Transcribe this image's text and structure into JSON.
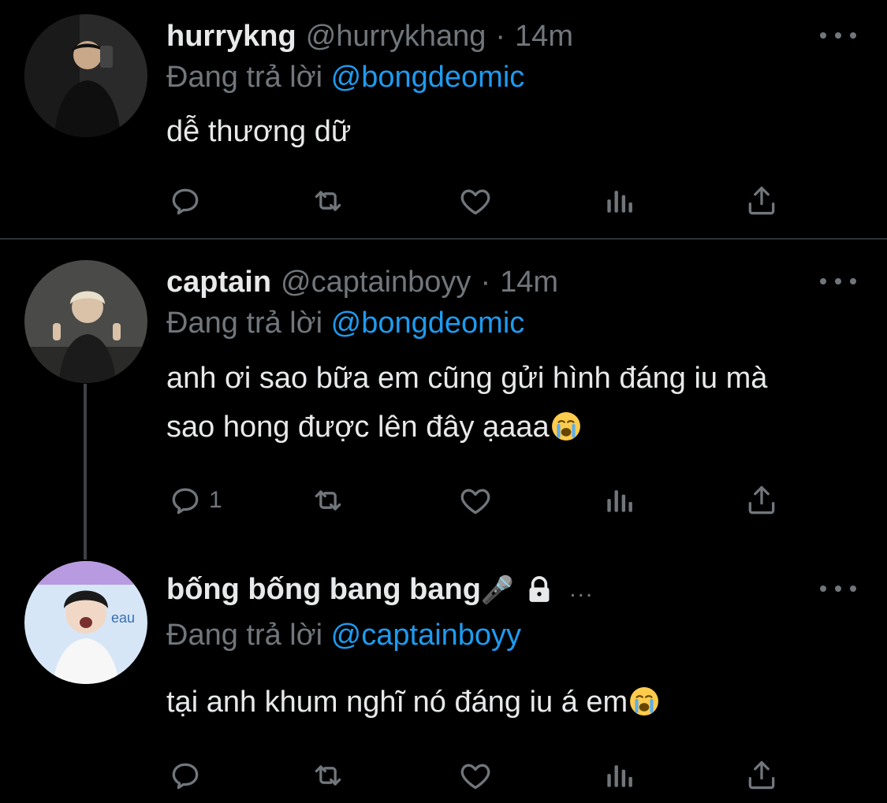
{
  "colors": {
    "background": "#000000",
    "text": "#e7e9ea",
    "muted": "#71767b",
    "accent": "#1d9bf0",
    "divider": "#2f3336"
  },
  "tweets": [
    {
      "name": "hurrykng",
      "handle": "@hurrykhang",
      "dot": "·",
      "time": "14m",
      "replying_prefix": "Đang trả lời",
      "replying_to": "@bongdeomic",
      "text": "dễ thương dữ",
      "reply_count": "",
      "icons": [
        "reply-icon",
        "retweet-icon",
        "like-icon",
        "analytics-icon",
        "share-icon",
        "more-icon"
      ]
    },
    {
      "name": "captain",
      "handle": "@captainboyy",
      "dot": "·",
      "time": "14m",
      "replying_prefix": "Đang trả lời",
      "replying_to": "@bongdeomic",
      "text_line1": "anh ơi sao bữa em cũng gửi hình đáng iu mà",
      "text_line2": "sao hong được lên đây ạaaa",
      "reply_count": "1",
      "icons": [
        "reply-icon",
        "retweet-icon",
        "like-icon",
        "analytics-icon",
        "share-icon",
        "more-icon"
      ]
    },
    {
      "name": "bống bống bang bang",
      "name_emoji": "🎤",
      "lock_icon": "lock-icon",
      "trail": "...",
      "replying_prefix": "Đang trả lời",
      "replying_to": "@captainboyy",
      "text": "tại anh khum nghĩ nó đáng iu á em",
      "reply_count": "",
      "icons": [
        "reply-icon",
        "retweet-icon",
        "like-icon",
        "analytics-icon",
        "share-icon",
        "more-icon"
      ]
    }
  ]
}
